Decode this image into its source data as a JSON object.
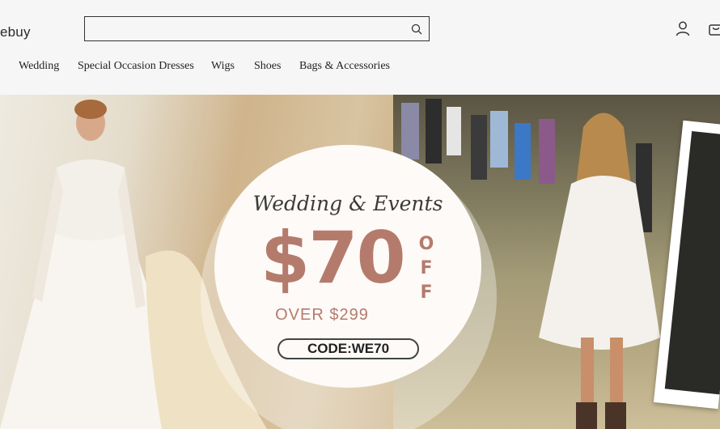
{
  "header": {
    "logo": "ebuy",
    "search": {
      "value": "",
      "placeholder": ""
    },
    "icons": [
      "search-icon",
      "user-icon",
      "cart-icon"
    ]
  },
  "nav": {
    "items": [
      {
        "label": "Wedding"
      },
      {
        "label": "Special Occasion Dresses"
      },
      {
        "label": "Wigs"
      },
      {
        "label": "Shoes"
      },
      {
        "label": "Bags & Accessories"
      }
    ]
  },
  "banner": {
    "script": "Wedding & Events",
    "amount": "$70",
    "off": [
      "O",
      "F",
      "F"
    ],
    "condition": "OVER $299",
    "code": "CODE:WE70"
  },
  "colors": {
    "promo_accent": "#b47b6d",
    "header_bg": "#f6f6f6"
  }
}
